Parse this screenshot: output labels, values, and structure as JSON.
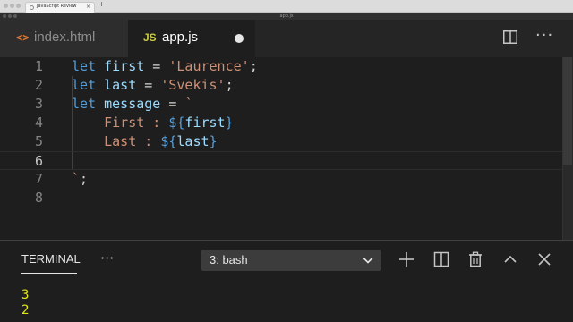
{
  "browser": {
    "tab_title": "JavaScript Review",
    "new_tab_symbol": "+",
    "close_symbol": "×",
    "window_title": "app.js"
  },
  "editor_tabs": [
    {
      "label": "index.html",
      "icon": "html-file-icon",
      "icon_text": "<>",
      "active": false
    },
    {
      "label": "app.js",
      "icon": "js-file-icon",
      "icon_text": "JS",
      "active": true,
      "unsaved": true
    }
  ],
  "editor_actions": {
    "split": "split-editor-icon",
    "more": "more-actions-icon",
    "more_text": "···"
  },
  "code": {
    "line_numbers": [
      "1",
      "2",
      "3",
      "4",
      "5",
      "6",
      "7",
      "8"
    ],
    "active_line": "6",
    "lines": [
      [
        {
          "t": "let ",
          "c": "kw"
        },
        {
          "t": "first",
          "c": "var"
        },
        {
          "t": " = ",
          "c": "op"
        },
        {
          "t": "'Laurence'",
          "c": "str"
        },
        {
          "t": ";",
          "c": "op"
        }
      ],
      [
        {
          "t": "let ",
          "c": "kw"
        },
        {
          "t": "last",
          "c": "var"
        },
        {
          "t": " = ",
          "c": "op"
        },
        {
          "t": "'Svekis'",
          "c": "str"
        },
        {
          "t": ";",
          "c": "op"
        }
      ],
      [
        {
          "t": "let ",
          "c": "kw"
        },
        {
          "t": "message",
          "c": "var"
        },
        {
          "t": " = ",
          "c": "op"
        },
        {
          "t": "`",
          "c": "str"
        }
      ],
      [
        {
          "t": "    First : ",
          "c": "str"
        },
        {
          "t": "${",
          "c": "tpl"
        },
        {
          "t": "first",
          "c": "var"
        },
        {
          "t": "}",
          "c": "tpl"
        }
      ],
      [
        {
          "t": "    Last : ",
          "c": "str"
        },
        {
          "t": "${",
          "c": "tpl"
        },
        {
          "t": "last",
          "c": "var"
        },
        {
          "t": "}",
          "c": "tpl"
        }
      ],
      [],
      [
        {
          "t": "`",
          "c": "str"
        },
        {
          "t": ";",
          "c": "op"
        }
      ],
      []
    ]
  },
  "panel": {
    "tab_label": "TERMINAL",
    "more_text": "···",
    "terminal_selected": "3: bash",
    "output": "3\n2"
  },
  "colors": {
    "keyword": "#569cd6",
    "variable": "#9cdcfe",
    "string": "#ce9178",
    "terminal_text": "#e5e510",
    "html_icon": "#e37933",
    "js_icon": "#cbcb41"
  }
}
